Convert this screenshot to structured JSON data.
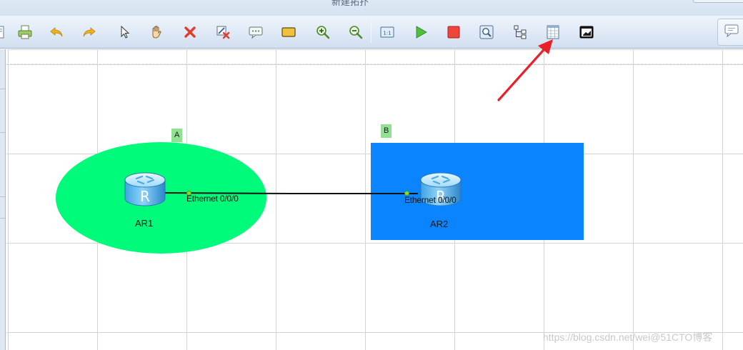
{
  "window": {
    "title": "新建拓扑"
  },
  "toolbar": {
    "buttons": [
      {
        "name": "new-topology",
        "icon": "new-icon"
      },
      {
        "name": "print",
        "icon": "print-icon"
      },
      {
        "name": "undo",
        "icon": "undo-icon"
      },
      {
        "name": "redo",
        "icon": "redo-icon"
      },
      {
        "name": "select",
        "icon": "pointer-icon"
      },
      {
        "name": "pan",
        "icon": "hand-icon"
      },
      {
        "name": "delete",
        "icon": "delete-icon"
      },
      {
        "name": "delete-link",
        "icon": "delete-link-icon"
      },
      {
        "name": "text",
        "icon": "text-note-icon"
      },
      {
        "name": "draw-shape",
        "icon": "rectangle-icon"
      },
      {
        "name": "zoom-in",
        "icon": "zoom-in-icon"
      },
      {
        "name": "zoom-out",
        "icon": "zoom-out-icon"
      },
      {
        "name": "fit-window",
        "icon": "fit-icon"
      },
      {
        "name": "start-devices",
        "icon": "play-icon"
      },
      {
        "name": "stop-devices",
        "icon": "stop-icon"
      },
      {
        "name": "capture",
        "icon": "capture-icon"
      },
      {
        "name": "topology-tree",
        "icon": "tree-icon"
      },
      {
        "name": "grid-toggle",
        "icon": "grid-icon"
      },
      {
        "name": "terminal",
        "icon": "terminal-icon"
      }
    ],
    "comment_panel_icon": "comment-icon"
  },
  "topology": {
    "areas": [
      {
        "id": "A",
        "label": "A",
        "shape": "ellipse",
        "color": "#00fa7a"
      },
      {
        "id": "B",
        "label": "B",
        "shape": "rectangle",
        "color": "#0b84ff"
      }
    ],
    "devices": [
      {
        "id": "AR1",
        "name": "AR1",
        "type": "router",
        "port": "Ethernet 0/0/0"
      },
      {
        "id": "AR2",
        "name": "AR2",
        "type": "router",
        "port": "Ethernet 0/0/0"
      }
    ],
    "link": {
      "from": "AR1",
      "to": "AR2",
      "color": "#111111"
    }
  },
  "annotation": {
    "arrow_color": "#e8202a",
    "points_to": "grid-toggle"
  },
  "watermark": "https://blog.csdn.net/wei@51CTO博客",
  "colors": {
    "grid_line": "#d4d4d4",
    "port_dot": "#8edc2a"
  }
}
